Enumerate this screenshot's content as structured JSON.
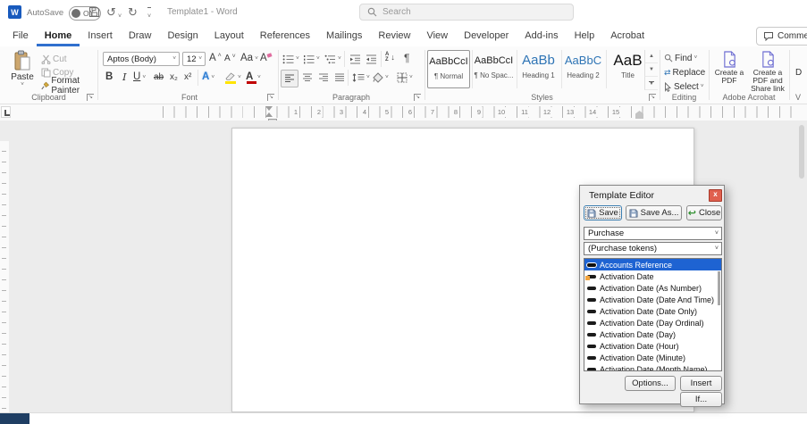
{
  "titlebar": {
    "app_logo": "W",
    "autosave_label": "AutoSave",
    "autosave_state": "Off",
    "doc_title": "Template1 - Word",
    "search_placeholder": "Search"
  },
  "menubar": {
    "tabs": [
      "File",
      "Home",
      "Insert",
      "Draw",
      "Design",
      "Layout",
      "References",
      "Mailings",
      "Review",
      "View",
      "Developer",
      "Add-ins",
      "Help",
      "Acrobat"
    ],
    "comments_label": "Comments"
  },
  "ribbon": {
    "clipboard": {
      "group_label": "Clipboard",
      "paste_label": "Paste",
      "cut_label": "Cut",
      "copy_label": "Copy",
      "format_painter_label": "Format Painter"
    },
    "font": {
      "group_label": "Font",
      "font_name": "Aptos (Body)",
      "font_size": "12",
      "grow_glyph": "A",
      "shrink_glyph": "A",
      "case_glyph": "Aa",
      "clear_glyph": "A",
      "bold_glyph": "B",
      "italic_glyph": "I",
      "underline_glyph": "U",
      "strike_glyph": "ab",
      "subscript_glyph": "x₂",
      "superscript_glyph": "x²",
      "effects_glyph": "A",
      "fontcolor_glyph": "A"
    },
    "paragraph": {
      "group_label": "Paragraph",
      "pilcrow_glyph": "¶",
      "sort_a": "A",
      "sort_z": "Z"
    },
    "styles": {
      "group_label": "Styles",
      "pilcrow": "¶",
      "items": [
        {
          "preview": "AaBbCcI",
          "name": "Normal"
        },
        {
          "preview": "AaBbCcI",
          "name": "No Spac..."
        },
        {
          "preview": "AaBb",
          "name": "Heading 1"
        },
        {
          "preview": "AaBbC",
          "name": "Heading 2"
        },
        {
          "preview": "AaB",
          "name": "Title"
        }
      ]
    },
    "editing": {
      "group_label": "Editing",
      "find_label": "Find",
      "replace_label": "Replace",
      "select_label": "Select"
    },
    "acrobat": {
      "group_label": "Adobe Acrobat",
      "create_pdf_label": "Create a PDF",
      "share_label": "Create a PDF and Share link"
    },
    "voice": {
      "dictate_partial": "D",
      "group_partial": "V"
    }
  },
  "ruler": {
    "numbers": [
      "1",
      "2",
      "3",
      "4",
      "5",
      "6",
      "7",
      "8",
      "9",
      "10",
      "11",
      "12",
      "13",
      "14",
      "15"
    ]
  },
  "dialog": {
    "title": "Template Editor",
    "close_x": "x",
    "save_label": "Save",
    "save_as_label": "Save As...",
    "close_label": "Close",
    "template_value": "Purchase",
    "token_group_value": "(Purchase tokens)",
    "tokens": [
      "Accounts Reference",
      "Activation Date",
      "Activation Date (As Number)",
      "Activation Date (Date And Time)",
      "Activation Date (Date Only)",
      "Activation Date (Day Ordinal)",
      "Activation Date (Day)",
      "Activation Date (Hour)",
      "Activation Date (Minute)",
      "Activation Date (Month Name)"
    ],
    "selected_token": "Accounts Reference",
    "options_label": "Options...",
    "insert_label": "Insert",
    "if_label": "If..."
  },
  "colors": {
    "accent_blue": "#185abd",
    "selection_blue": "#1e63d2",
    "heading_blue": "#2e74b5",
    "highlight_yellow": "#ffe400",
    "font_color_red": "#c00000",
    "dialog_close_red": "#e0604e"
  }
}
